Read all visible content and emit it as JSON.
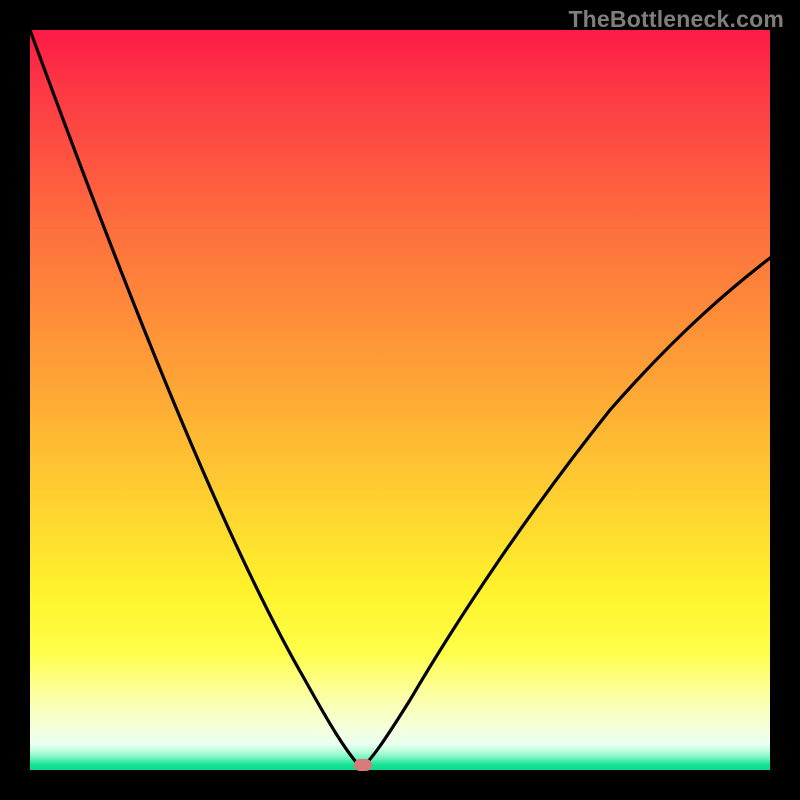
{
  "watermark_text": "TheBottleneck.com",
  "colors": {
    "background": "#000000",
    "curve_stroke": "#000000",
    "marker_fill": "#d77a78",
    "gradient_top": "#fd1a47",
    "gradient_bottom": "#0adc8f"
  },
  "chart_data": {
    "type": "line",
    "title": "",
    "xlabel": "",
    "ylabel": "",
    "xlim": [
      0,
      100
    ],
    "ylim": [
      0,
      100
    ],
    "x": [
      0,
      5,
      10,
      15,
      20,
      25,
      30,
      35,
      40,
      42,
      44,
      44.8,
      47,
      50,
      55,
      60,
      65,
      70,
      75,
      80,
      85,
      90,
      95,
      100
    ],
    "values": [
      100,
      86,
      72,
      59,
      47,
      36,
      26,
      17,
      9,
      5,
      1.5,
      0,
      2,
      7,
      14,
      22,
      29,
      36,
      43,
      49,
      55,
      60,
      65,
      69
    ],
    "marker": {
      "x": 44.8,
      "y": 0.6
    },
    "grid": false,
    "legend": false
  }
}
